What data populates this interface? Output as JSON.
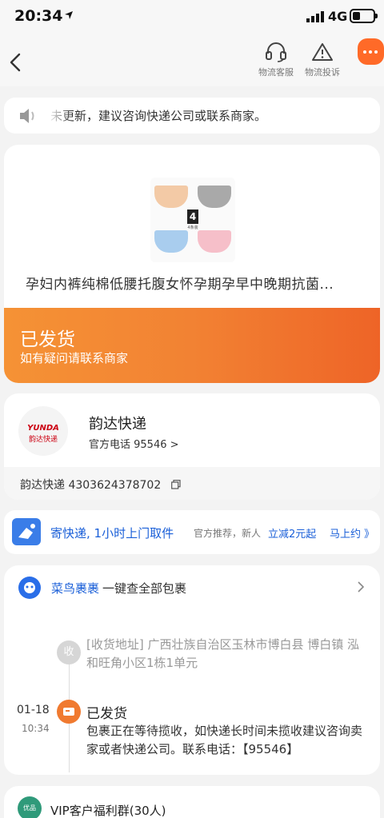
{
  "status_bar": {
    "time": "20:34",
    "network": "4G"
  },
  "nav": {
    "customer_service_label": "物流客服",
    "complaint_label": "物流投诉"
  },
  "notice": {
    "text": "未更新，建议咨询快递公司或联系商家。"
  },
  "product": {
    "name": "孕妇内裤纯棉低腰托腹女怀孕期孕早中晚期抗菌...",
    "thumb_badge": "4",
    "thumb_sub": "4条装",
    "colors": [
      "#f3caa6",
      "#a9a9a9",
      "#a9cdee",
      "#f6bfc9"
    ],
    "color_names": [
      "肤色",
      "灰色",
      "蓝色",
      "粉色"
    ]
  },
  "status": {
    "title": "已发货",
    "subtitle": "如有疑问请联系商家",
    "accent": "#ee6427"
  },
  "courier": {
    "logo_text": "YUNDA",
    "logo_sub": "韵达快递",
    "name": "韵达快递",
    "phone": "官方电话 95546 >",
    "tracking": "韵达快递 4303624378702"
  },
  "promo": {
    "title": "寄快递, 1小时上门取件",
    "recommend": "官方推荐，新人",
    "discount": "立减2元起",
    "action": "马上约 》"
  },
  "cainiao": {
    "brand": "菜鸟裹裹",
    "text": "一键查全部包裹"
  },
  "timeline": {
    "receive_badge": "收",
    "address": "[收货地址] 广西壮族自治区玉林市博白县 博白镇 泓和旺角小区1栋1单元",
    "event": {
      "date": "01-18",
      "time": "10:34",
      "status": "已发货",
      "description": "包裹正在等待揽收，如快递长时间未揽收建议咨询卖家或者快递公司。联系电话：【95546】"
    }
  },
  "vip": {
    "avatar_text": "优品",
    "text": "VIP客户福利群(30人)"
  }
}
